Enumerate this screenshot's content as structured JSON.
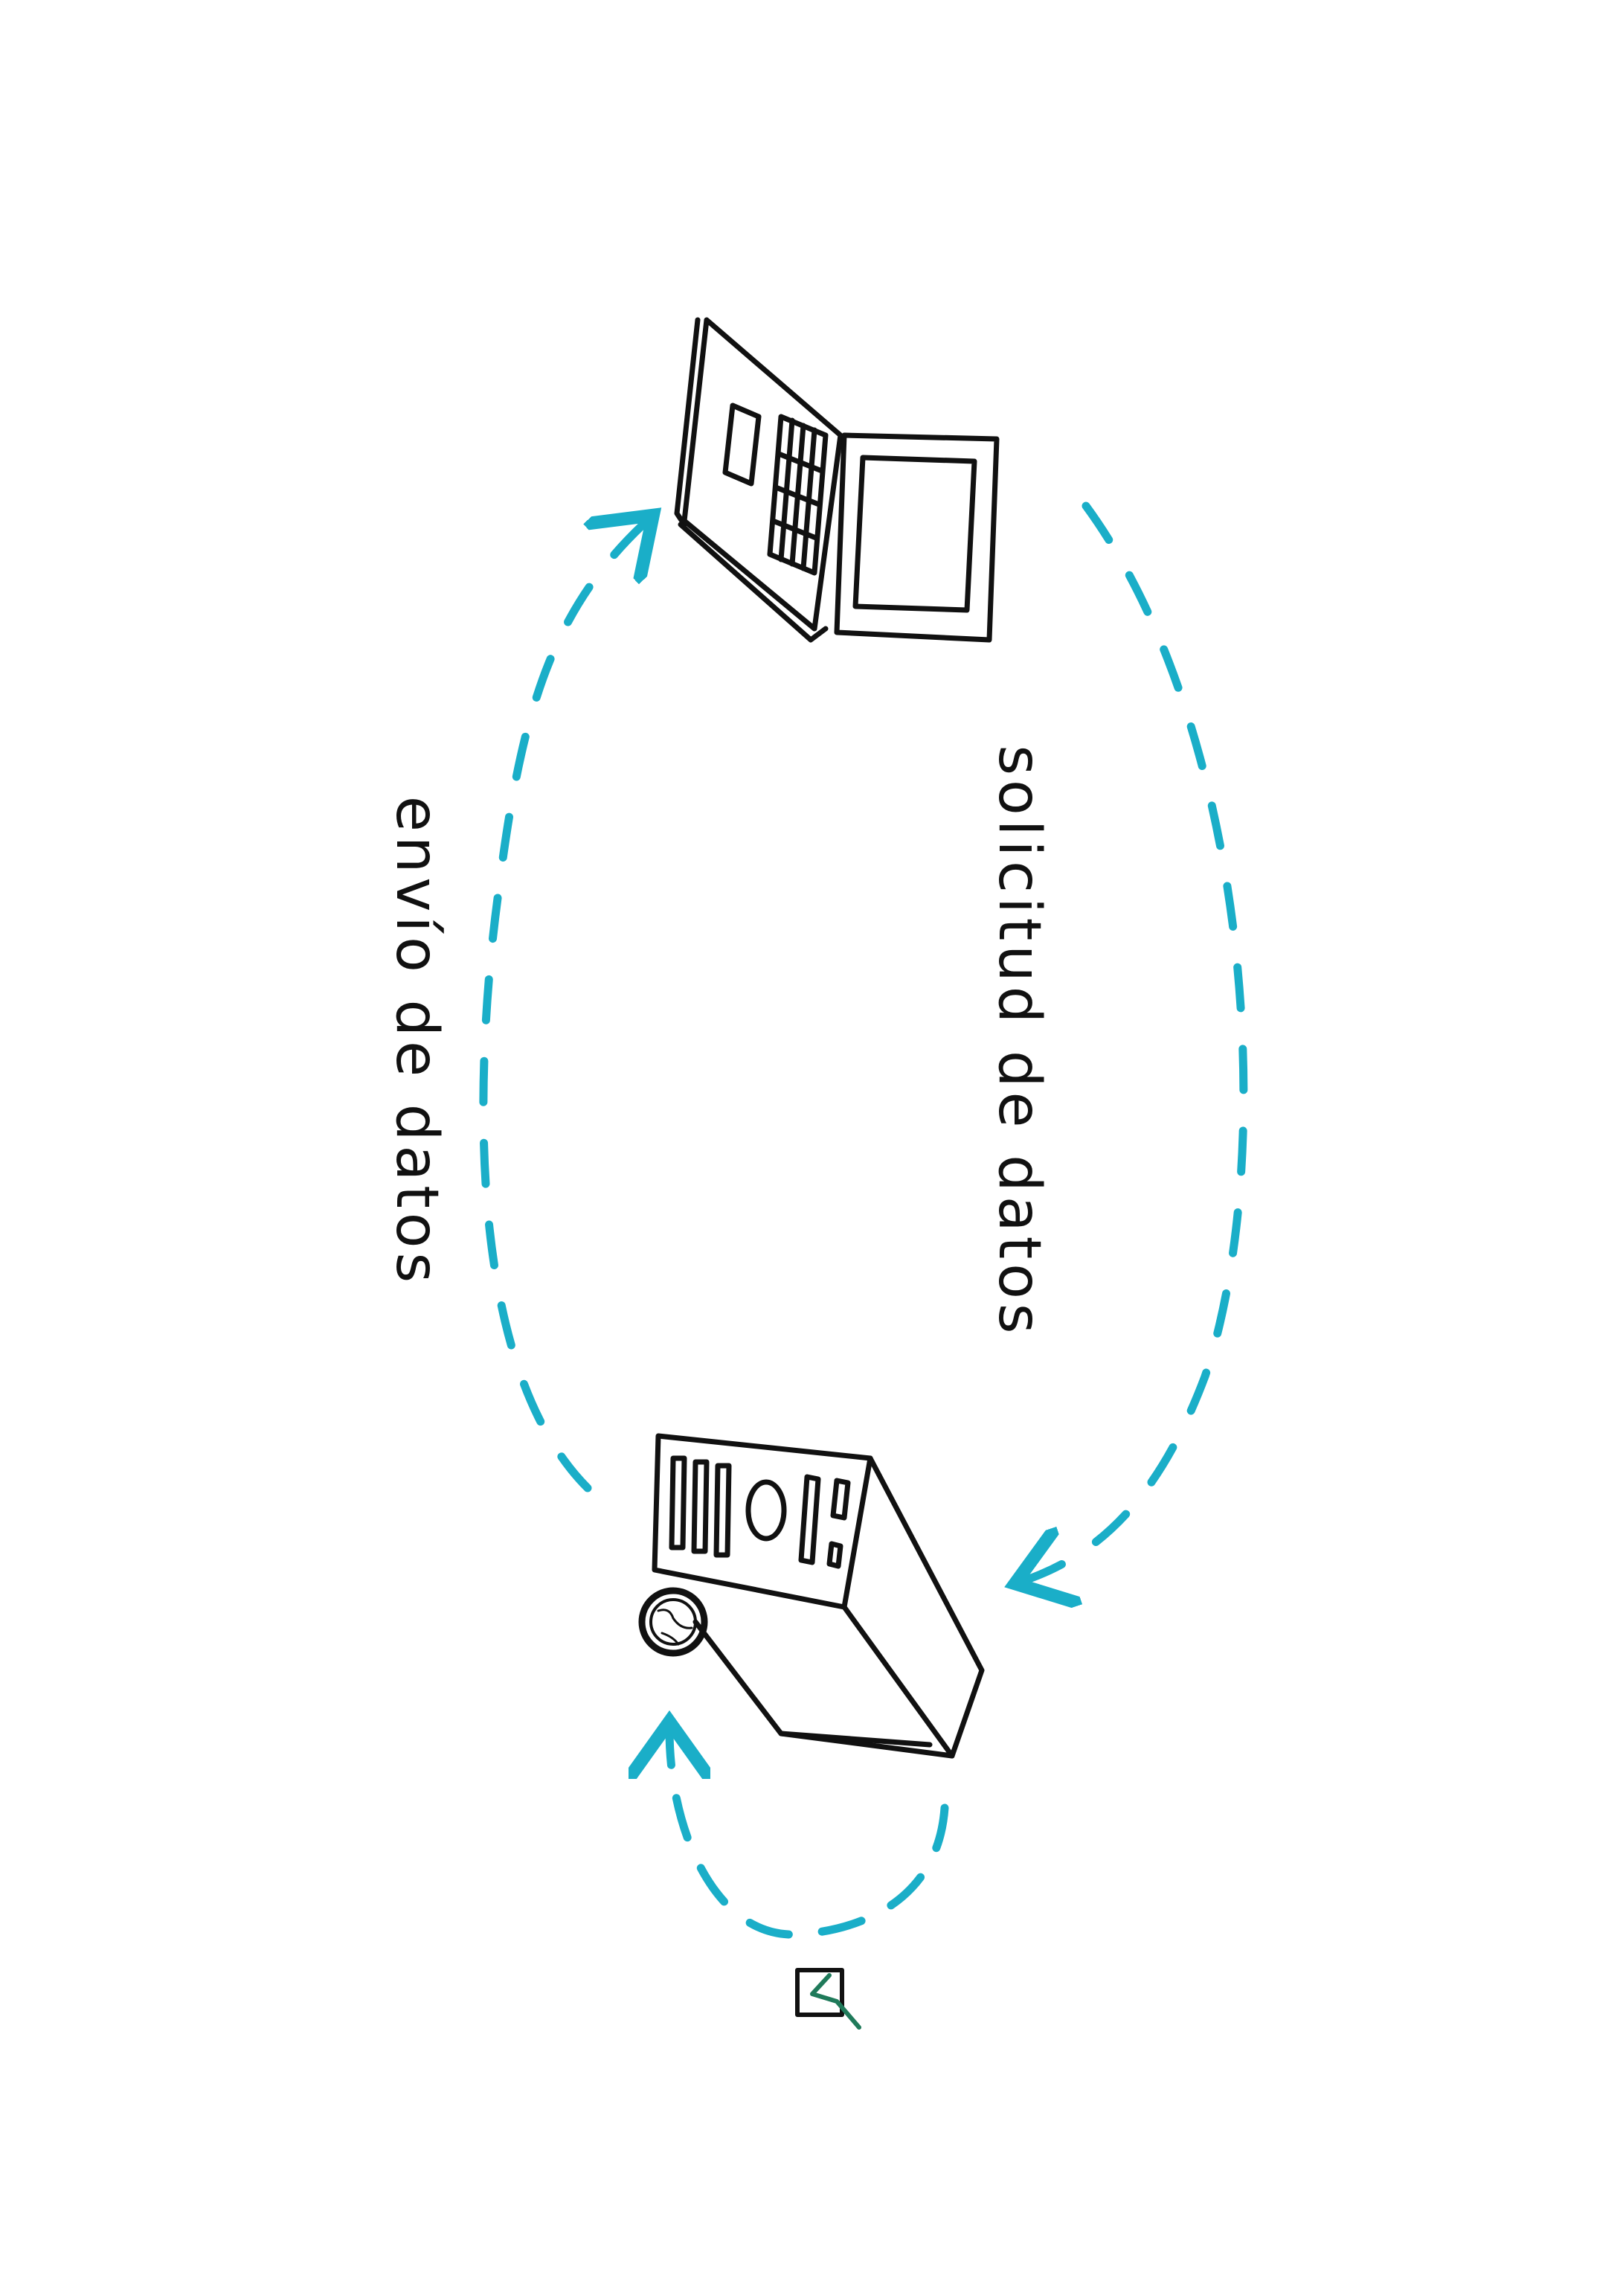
{
  "diagram": {
    "labels": {
      "request": "solicitud de datos",
      "send": "envío de datos"
    },
    "nodes": [
      {
        "id": "laptop",
        "icon": "laptop-icon"
      },
      {
        "id": "server",
        "icon": "server-tower-icon"
      },
      {
        "id": "globe",
        "icon": "globe-icon"
      },
      {
        "id": "marker",
        "icon": "flag-icon"
      }
    ],
    "colors": {
      "arrow": "#1aaec8",
      "ink": "#111111",
      "marker": "#1f7a5a"
    }
  }
}
